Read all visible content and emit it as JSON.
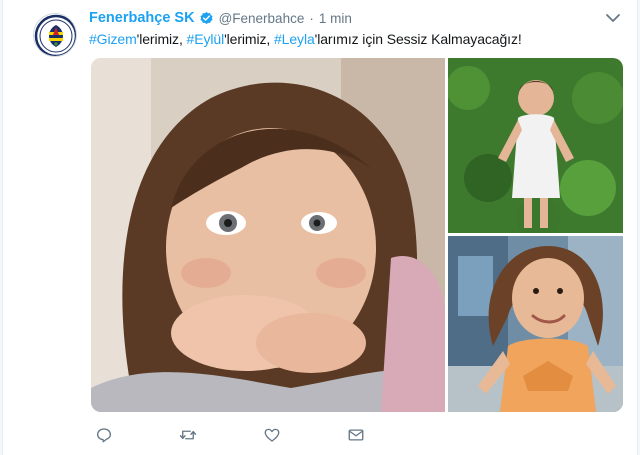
{
  "tweet": {
    "author_name": "Fenerbahçe SK",
    "author_handle": "@Fenerbahce",
    "separator": "·",
    "time": "1 min",
    "verified": true,
    "text_parts": [
      {
        "text": "#Gizem",
        "hashtag": true
      },
      {
        "text": "'lerimiz, ",
        "hashtag": false
      },
      {
        "text": "#Eylül",
        "hashtag": true
      },
      {
        "text": "'lerimiz, ",
        "hashtag": false
      },
      {
        "text": "#Leyla",
        "hashtag": true
      },
      {
        "text": "'larımız için Sessiz Kalmayacağız!",
        "hashtag": false
      }
    ],
    "photos": [
      {
        "description": "close-up portrait of a smiling little girl with brown hair"
      },
      {
        "description": "little girl in white dress standing in a green field"
      },
      {
        "description": "little girl in orange top smiling indoors"
      }
    ]
  },
  "actions": [
    "reply",
    "retweet",
    "like",
    "direct-message"
  ],
  "colors": {
    "link": "#1da1f2",
    "text": "#14171a",
    "muted": "#657786",
    "background": "#f5f8fa"
  },
  "icons": {
    "avatar": "fenerbahce-crest-icon",
    "verified": "verified-badge-icon",
    "caret": "chevron-down-icon",
    "reply": "reply-icon",
    "retweet": "retweet-icon",
    "like": "heart-icon",
    "dm": "envelope-icon"
  }
}
